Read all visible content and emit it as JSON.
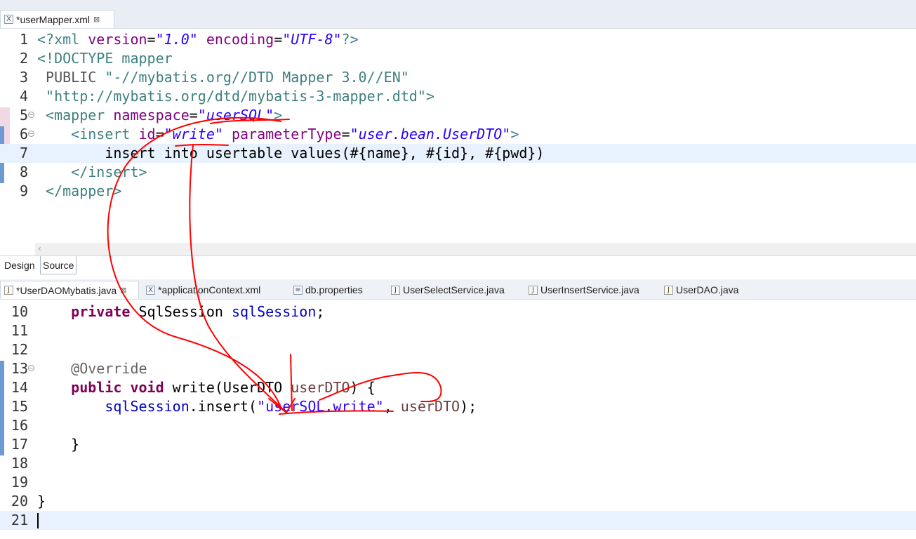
{
  "xml_editor": {
    "tab": {
      "label": "*userMapper.xml",
      "icon": "xml-file-icon"
    },
    "lines": [
      {
        "n": "1"
      },
      {
        "n": "2"
      },
      {
        "n": "3"
      },
      {
        "n": "4"
      },
      {
        "n": "5"
      },
      {
        "n": "6"
      },
      {
        "n": "7"
      },
      {
        "n": "8"
      },
      {
        "n": "9"
      }
    ],
    "code": {
      "l1_decl_open": "<?xml ",
      "l1_version_attr": "version",
      "l1_eq1": "=",
      "l1_version_val": "\"1.0\"",
      "l1_encoding_attr": " encoding",
      "l1_eq2": "=",
      "l1_encoding_val": "\"UTF-8\"",
      "l1_decl_close": "?>",
      "l2_doctype": "<!DOCTYPE mapper",
      "l3_public": " PUBLIC ",
      "l3_public_id": "\"-//mybatis.org//DTD Mapper 3.0//EN\"",
      "l4_system_id": " \"http://mybatis.org/dtd/mybatis-3-mapper.dtd\">",
      "l5_open": " <mapper ",
      "l5_ns_attr": "namespace",
      "l5_eq": "=",
      "l5_ns_val": "\"userSQL\"",
      "l5_close": ">",
      "l6_open": "    <insert ",
      "l6_id_attr": "id",
      "l6_eq1": "=",
      "l6_id_val": "\"write\"",
      "l6_pt_attr": " parameterType",
      "l6_eq2": "=",
      "l6_pt_val": "\"user.bean.UserDTO\"",
      "l6_close": ">",
      "l7_sql": "        insert into usertable values(#{name}, #{id}, #{pwd})",
      "l8_close": "    </insert>",
      "l9_close": " </mapper>"
    }
  },
  "mode_tabs": {
    "design": "Design",
    "source": "Source"
  },
  "java_tabs": [
    {
      "label": "*UserDAOMybatis.java",
      "icon": "java-file-icon",
      "active": true
    },
    {
      "label": "*applicationContext.xml",
      "icon": "xml-file-icon"
    },
    {
      "label": "db.properties",
      "icon": "properties-file-icon"
    },
    {
      "label": "UserSelectService.java",
      "icon": "java-file-icon"
    },
    {
      "label": "UserInsertService.java",
      "icon": "java-file-icon"
    },
    {
      "label": "UserDAO.java",
      "icon": "java-file-icon"
    }
  ],
  "java_editor": {
    "lines": [
      {
        "n": "10"
      },
      {
        "n": "11"
      },
      {
        "n": "12"
      },
      {
        "n": "13"
      },
      {
        "n": "14"
      },
      {
        "n": "15"
      },
      {
        "n": "16"
      },
      {
        "n": "17"
      },
      {
        "n": "18"
      },
      {
        "n": "19"
      },
      {
        "n": "20"
      },
      {
        "n": "21"
      }
    ],
    "code": {
      "l10_kw": "    private",
      "l10_type": " SqlSession ",
      "l10_field": "sqlSession",
      "l10_semi": ";",
      "l13_ann": "    @Override",
      "l14_kw": "    public void",
      "l14_sig": " write(UserDTO ",
      "l14_param": "userDTO",
      "l14_end": ") {",
      "l15_field": "        sqlSession",
      "l15_call": ".insert(",
      "l15_str": "\"userSQL.write\"",
      "l15_comma": ", ",
      "l15_arg": "userDTO",
      "l15_end": ");",
      "l17_close": "    }",
      "l20_close": "}"
    }
  },
  "colors": {
    "xml_tag": "#3f7f7f",
    "xml_attr": "#7f007f",
    "xml_value": "#2a00ff",
    "java_keyword": "#7f0055",
    "java_field": "#0000c0",
    "current_line": "#e8f2fe",
    "change_marker": "#6b9bd2",
    "annotation_ink": "#ff0000"
  }
}
